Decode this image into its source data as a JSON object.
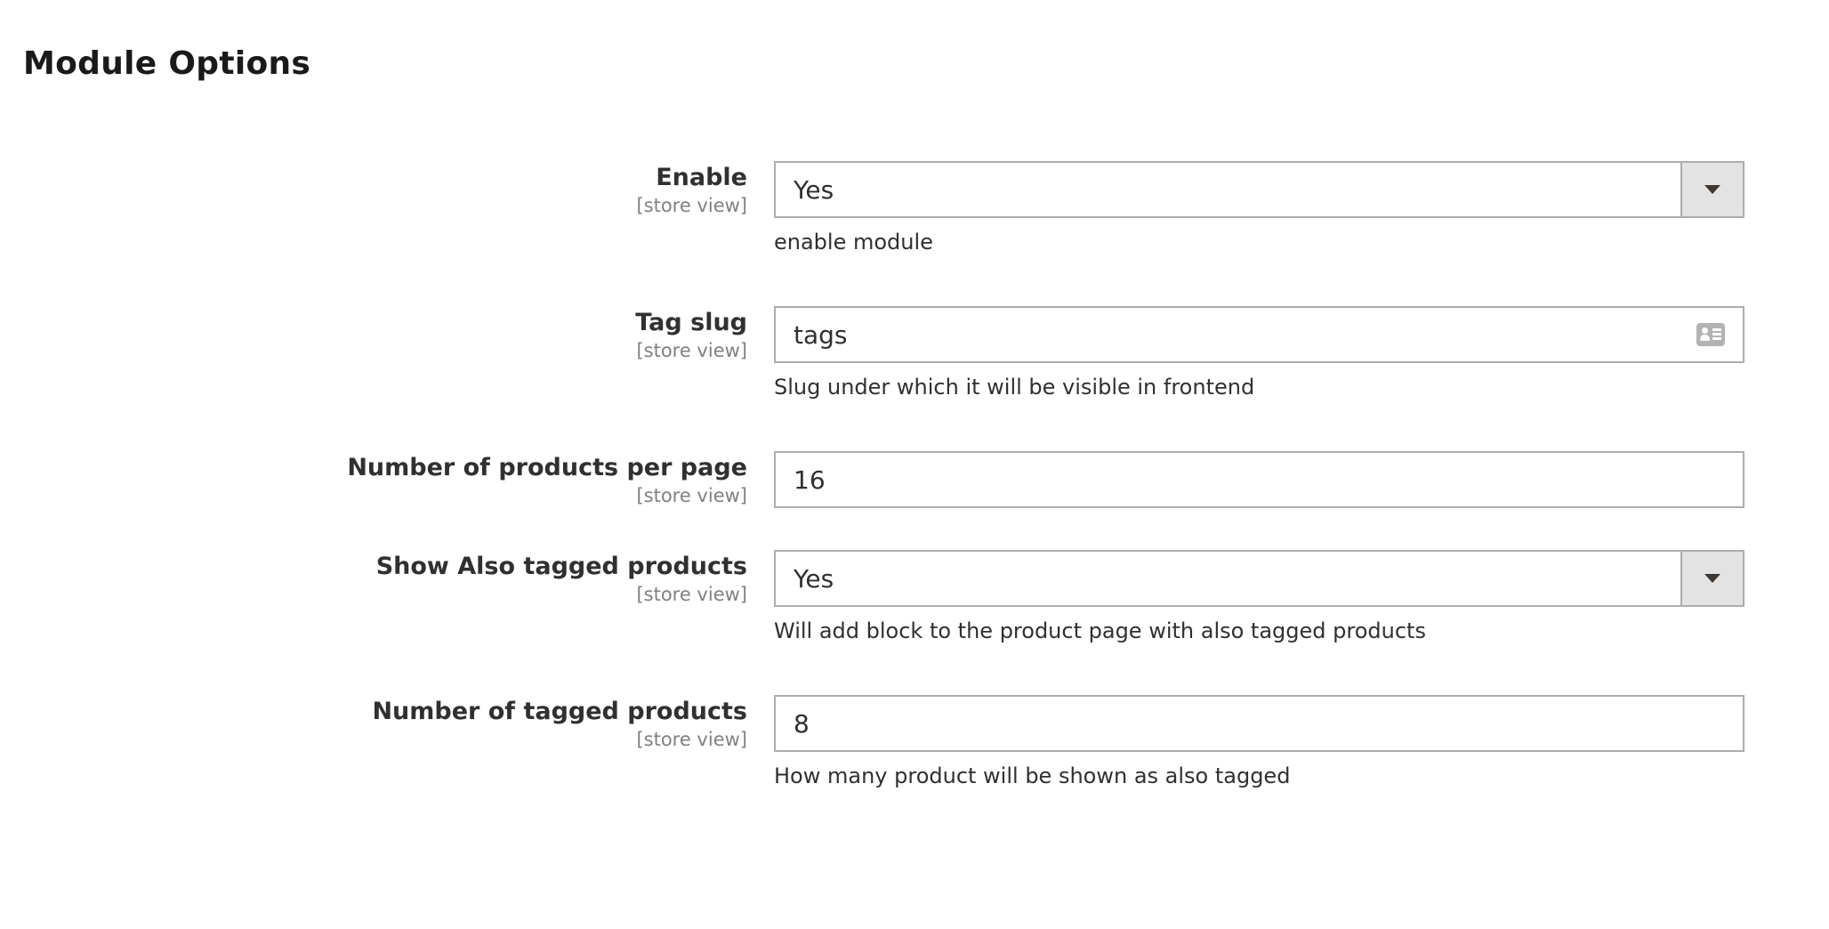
{
  "section": {
    "title": "Module Options"
  },
  "fields": [
    {
      "label": "Enable",
      "scope": "[store view]",
      "type": "select",
      "value": "Yes",
      "note": "enable module"
    },
    {
      "label": "Tag slug",
      "scope": "[store view]",
      "type": "text",
      "value": "tags",
      "icon": "contact-card-icon",
      "note": "Slug under which it will be visible in frontend"
    },
    {
      "label": "Number of products per page",
      "scope": "[store view]",
      "type": "text",
      "value": "16"
    },
    {
      "label": "Show Also tagged products",
      "scope": "[store view]",
      "type": "select",
      "value": "Yes",
      "note": "Will add block to the product page with also tagged products"
    },
    {
      "label": "Number of tagged products",
      "scope": "[store view]",
      "type": "text",
      "value": "8",
      "note": "How many product will be shown as also tagged"
    }
  ]
}
